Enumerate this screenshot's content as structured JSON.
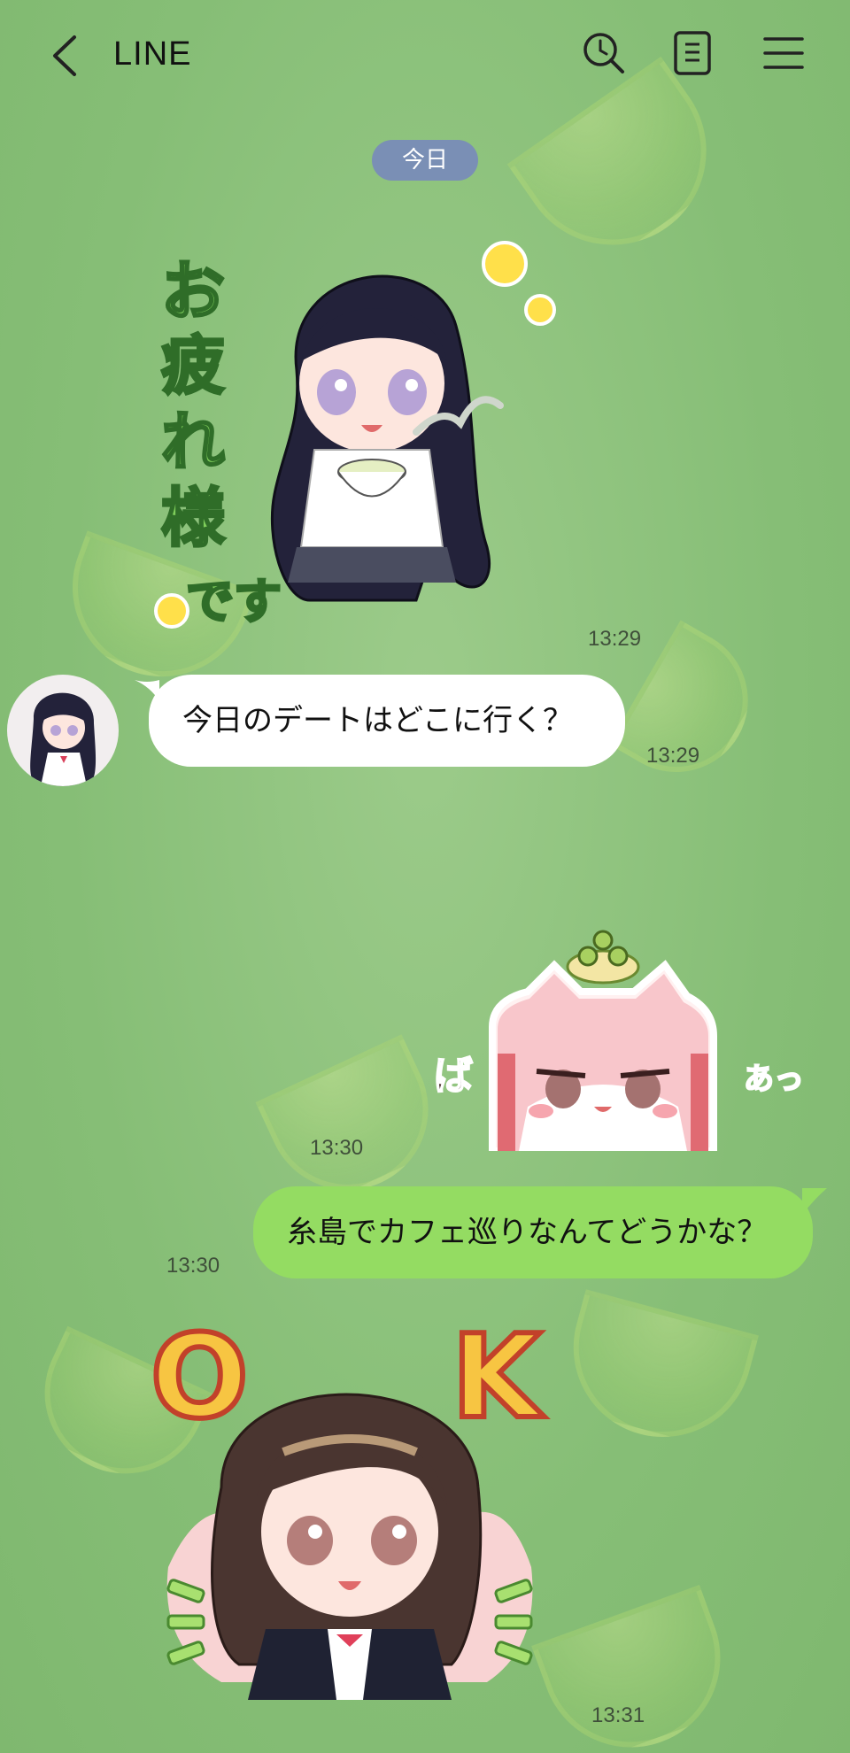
{
  "header": {
    "back_icon": "chevron-left-icon",
    "title": "LINE",
    "icons": [
      "history-search-icon",
      "notes-icon",
      "menu-icon"
    ]
  },
  "date_separator": "今日",
  "messages": [
    {
      "type": "sticker",
      "from": "other",
      "sticker_text": "お疲れ様です",
      "time": "13:29"
    },
    {
      "type": "text",
      "from": "other",
      "text": "今日のデートはどこに行く？",
      "time": "13:29"
    },
    {
      "type": "sticker",
      "from": "me",
      "sticker_text": "ばあっ",
      "time": "13:30"
    },
    {
      "type": "text",
      "from": "me",
      "text": "糸島でカフェ巡りなんてどうかな？",
      "time": "13:30"
    },
    {
      "type": "sticker",
      "from": "other",
      "sticker_text": "OK",
      "time": "13:31"
    }
  ],
  "colors": {
    "background": "#8cc27d",
    "date_pill": "#7a8fb5",
    "bubble_incoming": "#ffffff",
    "bubble_outgoing": "#94dc62"
  }
}
